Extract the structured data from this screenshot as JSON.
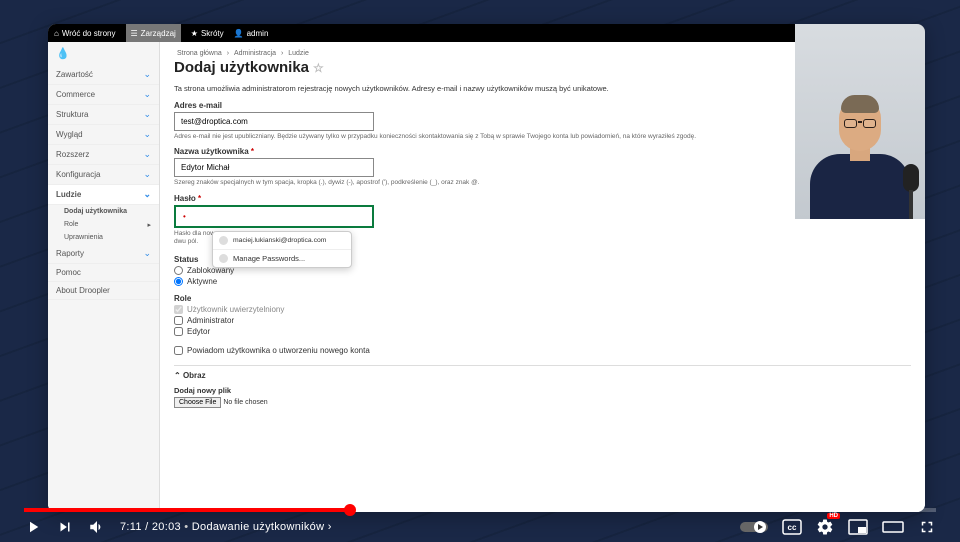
{
  "topbar": {
    "back": "Wróć do strony",
    "manage": "Zarządzaj",
    "shortcuts": "Skróty",
    "user": "admin"
  },
  "sidebar": {
    "items": [
      {
        "label": "Zawartość"
      },
      {
        "label": "Commerce"
      },
      {
        "label": "Struktura"
      },
      {
        "label": "Wygląd"
      },
      {
        "label": "Rozszerz"
      },
      {
        "label": "Konfiguracja"
      },
      {
        "label": "Ludzie"
      },
      {
        "label": "Raporty"
      },
      {
        "label": "Pomoc"
      },
      {
        "label": "About Droopler"
      }
    ],
    "subs": [
      {
        "label": "Dodaj użytkownika"
      },
      {
        "label": "Role"
      },
      {
        "label": "Uprawnienia"
      }
    ]
  },
  "breadcrumb": [
    "Strona główna",
    "Administracja",
    "Ludzie"
  ],
  "page_title": "Dodaj użytkownika",
  "intro": "Ta strona umożliwia administratorom rejestrację nowych użytkowników. Adresy e-mail i nazwy użytkowników muszą być unikatowe.",
  "form": {
    "email_label": "Adres e-mail",
    "email_value": "test@droptica.com",
    "email_help": "Adres e-mail nie jest upubliczniany. Będzie używany tylko w przypadku konieczności skontaktowania się z Tobą w sprawie Twojego konta lub powiadomień, na które wyraziłeś zgodę.",
    "username_label": "Nazwa użytkownika",
    "username_value": "Edytor Michał",
    "username_help": "Szereg znaków specjalnych w tym spacja, kropka (.), dywiz (-), apostrof ('), podkreślenie (_), oraz znak @.",
    "password_label": "Hasło",
    "password_help_a": "Hasło dla nowego",
    "password_help_b": "dwu pól.",
    "status_label": "Status",
    "status_blocked": "Zablokowany",
    "status_active": "Aktywne",
    "role_label": "Role",
    "role_auth": "Użytkownik uwierzytelniony",
    "role_admin": "Administrator",
    "role_editor": "Edytor",
    "notify": "Powiadom użytkownika o utworzeniu nowego konta",
    "image_section": "Obraz",
    "add_file": "Dodaj nowy plik",
    "choose_file": "Choose File",
    "no_file": "No file chosen"
  },
  "autocomplete": {
    "suggestion": "maciej.lukianski@droptica.com",
    "manage": "Manage Passwords..."
  },
  "player": {
    "current": "7:11",
    "total": "20:03",
    "chapter": "Dodawanie użytkowników",
    "hd": "HD"
  }
}
